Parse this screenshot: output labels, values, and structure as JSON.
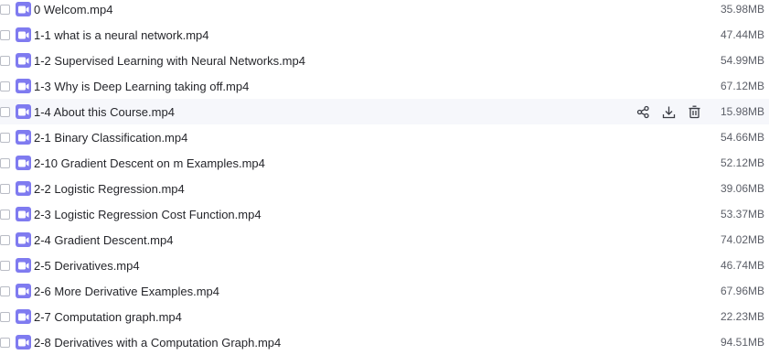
{
  "files": [
    {
      "name": "0 Welcom.mp4",
      "size": "35.98MB"
    },
    {
      "name": "1-1 what is a neural network.mp4",
      "size": "47.44MB"
    },
    {
      "name": "1-2 Supervised Learning with Neural Networks.mp4",
      "size": "54.99MB"
    },
    {
      "name": "1-3 Why is Deep Learning taking off.mp4",
      "size": "67.12MB"
    },
    {
      "name": "1-4 About this Course.mp4",
      "size": "15.98MB"
    },
    {
      "name": "2-1 Binary Classification.mp4",
      "size": "54.66MB"
    },
    {
      "name": "2-10 Gradient Descent on m Examples.mp4",
      "size": "52.12MB"
    },
    {
      "name": "2-2 Logistic Regression.mp4",
      "size": "39.06MB"
    },
    {
      "name": "2-3 Logistic Regression Cost Function.mp4",
      "size": "53.37MB"
    },
    {
      "name": "2-4 Gradient Descent.mp4",
      "size": "74.02MB"
    },
    {
      "name": "2-5 Derivatives.mp4",
      "size": "46.74MB"
    },
    {
      "name": "2-6 More Derivative Examples.mp4",
      "size": "67.96MB"
    },
    {
      "name": "2-7 Computation graph.mp4",
      "size": "22.23MB"
    },
    {
      "name": "2-8 Derivatives with a Computation Graph.mp4",
      "size": "94.51MB"
    }
  ],
  "hovered_index": 4,
  "row_actions": [
    "share-icon",
    "download-icon",
    "delete-icon"
  ],
  "colors": {
    "video_icon": "#7f7bf0",
    "hover_row": "#f6f7fb",
    "text": "#25262b",
    "size_text": "#5d6069"
  }
}
